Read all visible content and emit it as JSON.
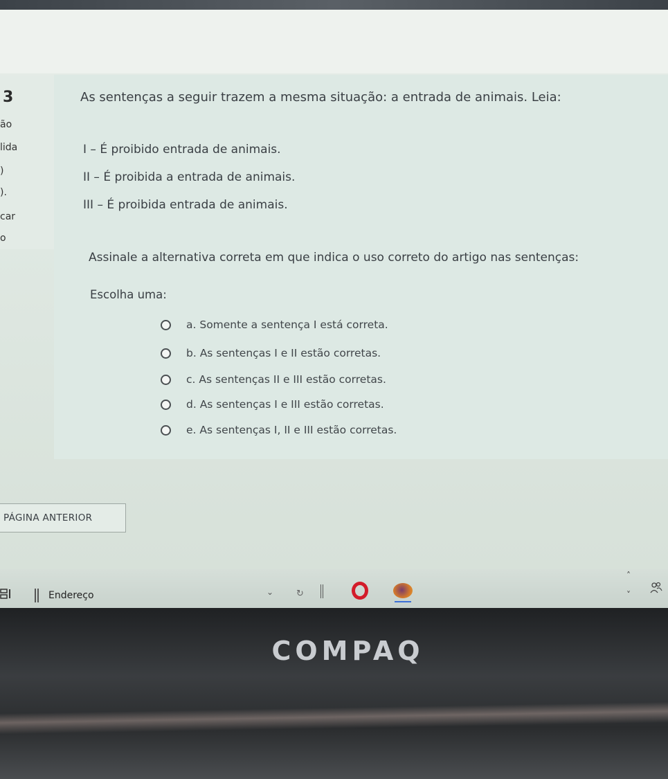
{
  "question": {
    "number": "3",
    "sidebar_fragments": [
      "ão",
      "lida",
      ")",
      ").",
      "car",
      "o"
    ],
    "intro": "As sentenças a seguir trazem a mesma situação: a entrada de animais. Leia:",
    "statements": [
      "I – É proibido entrada de animais.",
      "II – É proibida a entrada de animais.",
      "III – É proibida entrada de animais."
    ],
    "prompt": "Assinale a alternativa correta em que indica o uso correto do artigo nas sentenças:",
    "choose_label": "Escolha uma:",
    "options": [
      "a. Somente a sentença I está correta.",
      "b. As sentenças I e II estão corretas.",
      "c. As sentenças II e III estão corretas.",
      "d. As sentenças I e III estão corretas.",
      "e. As sentenças I, II e III estão corretas."
    ]
  },
  "navigation": {
    "previous_label": "PÁGINA ANTERIOR"
  },
  "taskbar": {
    "address_label": "Endereço"
  },
  "bezel": {
    "brand": "COMPAQ"
  }
}
